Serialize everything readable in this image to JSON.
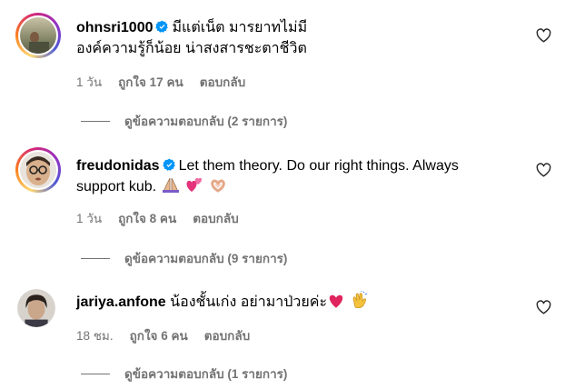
{
  "comments": [
    {
      "username": "ohnsri1000",
      "text_line1": "มีแต่เน็ต มารยาทไม่มี",
      "text_line2": "องค์ความรู้ก็น้อย น่าสงสารชะตาชีวิต",
      "time": "1 วัน",
      "likes": "ถูกใจ 17 คน",
      "reply": "ตอบกลับ",
      "view_replies": "ดูข้อความตอบกลับ (2 รายการ)",
      "verified": true
    },
    {
      "username": "freudonidas",
      "text_line1": "Let them theory. Do our right things. Always",
      "text_line2": "support kub.",
      "time": "1 วัน",
      "likes": "ถูกใจ 8 คน",
      "reply": "ตอบกลับ",
      "view_replies": "ดูข้อความตอบกลับ (9 รายการ)",
      "verified": true,
      "emojis": [
        "praying-hands-emoji",
        "two-hearts-emoji",
        "heart-hands-emoji"
      ]
    },
    {
      "username": "jariya.anfone",
      "text_line1": "น้องชั้นเก่ง อย่ามาป่วยค่ะ",
      "time": "18 ชม.",
      "likes": "ถูกใจ 6 คน",
      "reply": "ตอบกลับ",
      "view_replies": "ดูข้อความตอบกลับ (1 รายการ)",
      "verified": false,
      "emojis": [
        "heart-emoji",
        "clapping-hands-emoji"
      ]
    }
  ],
  "colors": {
    "verified": "#0095f6",
    "meta": "#737373",
    "heart_emoji": "#e0245e"
  },
  "icons": {
    "like": "heart-outline-icon",
    "verified": "verified-badge-icon"
  }
}
